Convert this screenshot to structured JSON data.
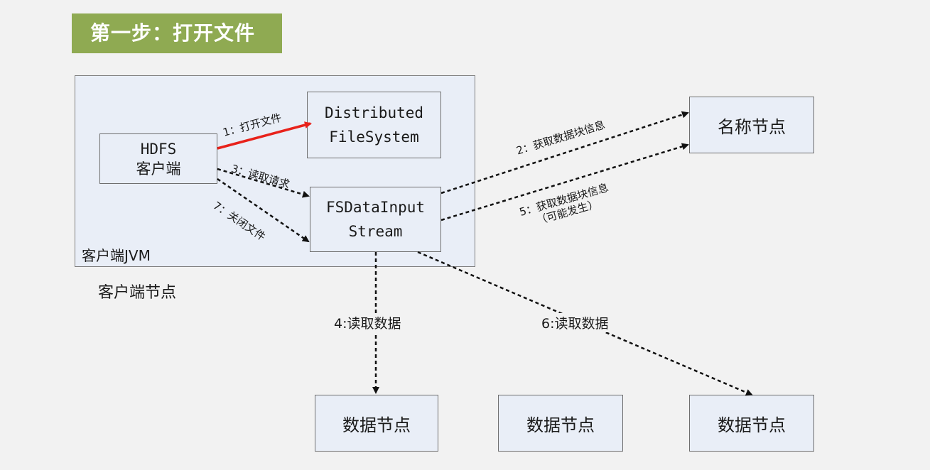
{
  "title": "第一步：打开文件",
  "client_jvm_label": "客户端JVM",
  "client_node_label": "客户端节点",
  "boxes": {
    "hdfs_client": [
      "HDFS",
      "客户端"
    ],
    "distributed_fs": [
      "Distributed",
      "FileSystem"
    ],
    "fs_data_input_stream": [
      "FSDataInput",
      "Stream"
    ],
    "name_node": "名称节点",
    "data_node_1": "数据节点",
    "data_node_2": "数据节点",
    "data_node_3": "数据节点"
  },
  "edges": {
    "e1": "1：打开文件",
    "e2": "2：获取数据块信息",
    "e3": "3：读取请求",
    "e4": "4:读取数据",
    "e5_line1": "5：获取数据块信息",
    "e5_line2": "（可能发生）",
    "e6": "6:读取数据",
    "e7": "7：关闭文件"
  },
  "colors": {
    "title_banner": "#8faa52",
    "box_fill": "#e9eef7",
    "open_file_arrow": "#e8221b",
    "dashed_arrow": "#111111"
  }
}
